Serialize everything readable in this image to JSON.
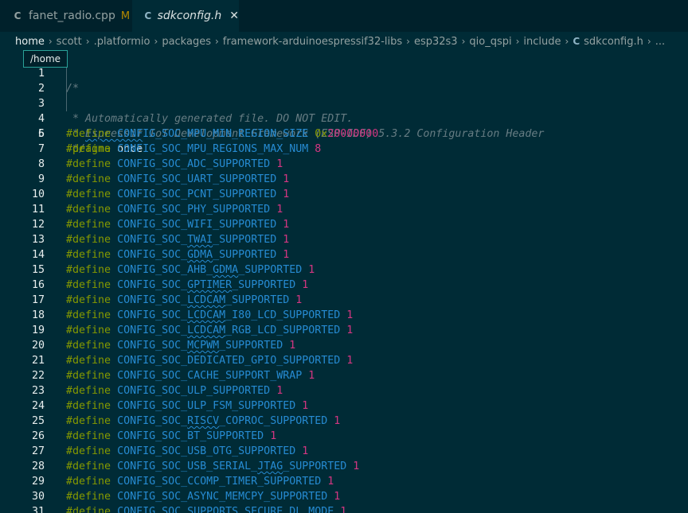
{
  "tabs": [
    {
      "name": "fanet_radio.cpp",
      "icon": "C",
      "status": "M",
      "active": false
    },
    {
      "name": "sdkconfig.h",
      "icon": "C",
      "close": "✕",
      "active": true
    }
  ],
  "breadcrumb": {
    "segments": [
      "home",
      "scott",
      ".platformio",
      "packages",
      "framework-arduinoespressif32-libs",
      "esp32s3",
      "qio_qspi",
      "include"
    ],
    "file_icon": "C",
    "file": "sdkconfig.h",
    "more": "..."
  },
  "tooltip": "/home",
  "comment": {
    "line1": "/*",
    "line2": " * Automatically generated file. DO NOT EDIT.",
    "line3_pre": " * ",
    "line3_sq": "Espressif",
    "line3_post": " IoT Development Framework (ESP-IDF) 5.3.2 Configuration Header",
    "line4": " */"
  },
  "pragma": {
    "directive": "#pragma",
    "arg": "once"
  },
  "define_keyword": "#define",
  "defines": [
    {
      "n": 6,
      "pre": "CONFIG_SOC_MPU_MIN_REGION_SIZE",
      "val": "0x20000000"
    },
    {
      "n": 7,
      "pre": "CONFIG_SOC_MPU_REGIONS_MAX_NUM",
      "val": "8"
    },
    {
      "n": 8,
      "pre": "CONFIG_SOC_ADC_SUPPORTED",
      "val": "1"
    },
    {
      "n": 9,
      "pre": "CONFIG_SOC_UART_SUPPORTED",
      "val": "1"
    },
    {
      "n": 10,
      "pre": "CONFIG_SOC_PCNT_SUPPORTED",
      "val": "1"
    },
    {
      "n": 11,
      "pre": "CONFIG_SOC_PHY_SUPPORTED",
      "val": "1"
    },
    {
      "n": 12,
      "pre": "CONFIG_SOC_WIFI_SUPPORTED",
      "val": "1"
    },
    {
      "n": 13,
      "pre": "CONFIG_SOC_",
      "sq": "TWAI",
      "post": "_SUPPORTED",
      "val": "1"
    },
    {
      "n": 14,
      "pre": "CONFIG_SOC_",
      "sq": "GDMA",
      "post": "_SUPPORTED",
      "val": "1"
    },
    {
      "n": 15,
      "pre": "CONFIG_SOC_AHB_",
      "sq": "GDMA",
      "post": "_SUPPORTED",
      "val": "1"
    },
    {
      "n": 16,
      "pre": "CONFIG_SOC_",
      "sq": "GPTIMER",
      "post": "_SUPPORTED",
      "val": "1"
    },
    {
      "n": 17,
      "pre": "CONFIG_SOC_",
      "sq": "LCDCAM",
      "post": "_SUPPORTED",
      "val": "1"
    },
    {
      "n": 18,
      "pre": "CONFIG_SOC_",
      "sq": "LCDCAM",
      "post": "_I80_LCD_SUPPORTED",
      "val": "1"
    },
    {
      "n": 19,
      "pre": "CONFIG_SOC_",
      "sq": "LCDCAM",
      "post": "_RGB_LCD_SUPPORTED",
      "val": "1"
    },
    {
      "n": 20,
      "pre": "CONFIG_SOC_",
      "sq": "MCPWM",
      "post": "_SUPPORTED",
      "val": "1"
    },
    {
      "n": 21,
      "pre": "CONFIG_SOC_DEDICATED_GPIO_SUPPORTED",
      "val": "1"
    },
    {
      "n": 22,
      "pre": "CONFIG_SOC_CACHE_SUPPORT_WRAP",
      "val": "1"
    },
    {
      "n": 23,
      "pre": "CONFIG_SOC_ULP_SUPPORTED",
      "val": "1"
    },
    {
      "n": 24,
      "pre": "CONFIG_SOC_ULP_FSM_SUPPORTED",
      "val": "1"
    },
    {
      "n": 25,
      "pre": "CONFIG_SOC_",
      "sq": "RISCV",
      "post": "_COPROC_SUPPORTED",
      "val": "1"
    },
    {
      "n": 26,
      "pre": "CONFIG_SOC_BT_SUPPORTED",
      "val": "1"
    },
    {
      "n": 27,
      "pre": "CONFIG_SOC_USB_OTG_SUPPORTED",
      "val": "1"
    },
    {
      "n": 28,
      "pre": "CONFIG_SOC_USB_SERIAL_",
      "sq": "JTAG",
      "post": "_SUPPORTED",
      "val": "1"
    },
    {
      "n": 29,
      "pre": "CONFIG_SOC_CCOMP_TIMER_SUPPORTED",
      "val": "1"
    },
    {
      "n": 30,
      "pre": "CONFIG_SOC_ASYNC_MEMCPY_SUPPORTED",
      "val": "1"
    },
    {
      "n": 31,
      "pre": "CONFIG_SOC_SUPPORTS_SECURE_DL_MODE",
      "val": "1"
    }
  ],
  "colors": {
    "background": "#002b36",
    "tabbar": "#00212b",
    "keyword": "#859900",
    "identifier": "#268bd2",
    "number": "#d33682",
    "comment": "#667c83",
    "modified": "#b58900"
  }
}
